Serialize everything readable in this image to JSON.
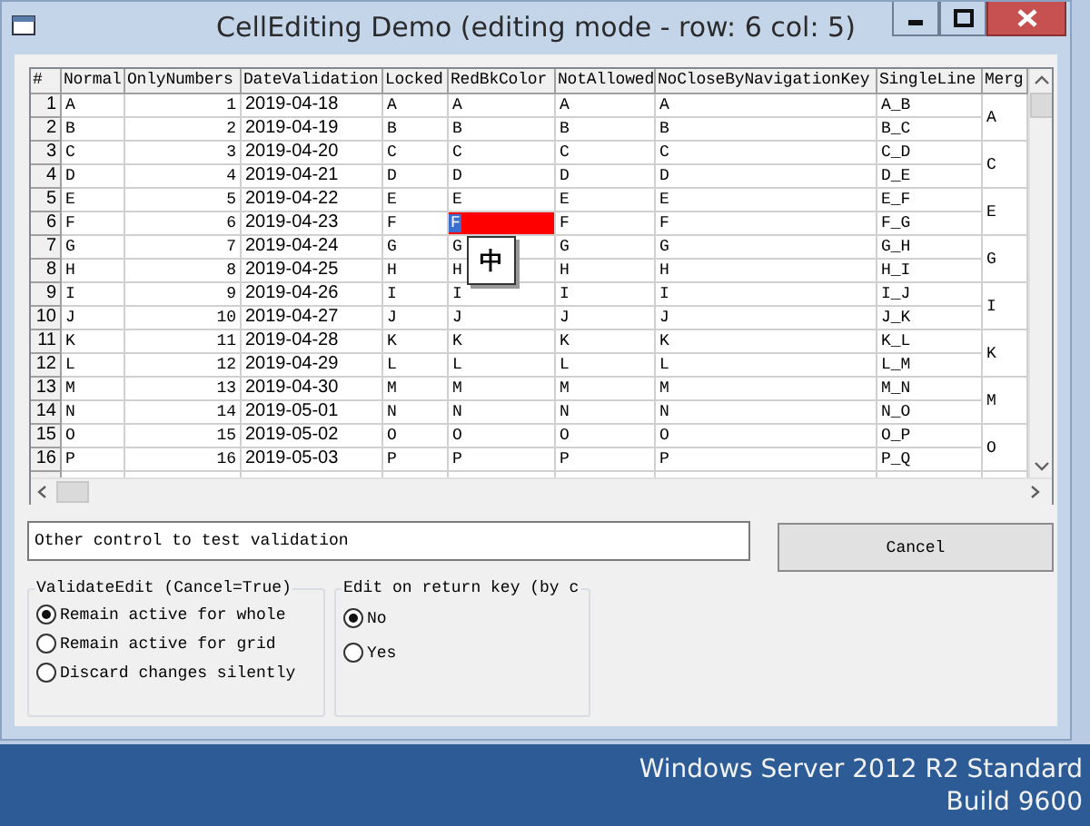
{
  "window": {
    "title": "CellEditing Demo (editing mode - row: 6 col: 5)"
  },
  "grid": {
    "columns": [
      {
        "label": "#",
        "kind": "rownum"
      },
      {
        "label": "Normal",
        "kind": "text"
      },
      {
        "label": "OnlyNumbers",
        "kind": "number"
      },
      {
        "label": "DateValidation",
        "kind": "text"
      },
      {
        "label": "Locked",
        "kind": "text"
      },
      {
        "label": "RedBkColor",
        "kind": "redbk"
      },
      {
        "label": "NotAllowed",
        "kind": "text"
      },
      {
        "label": "NoCloseByNavigationKey",
        "kind": "text"
      },
      {
        "label": "SingleLine",
        "kind": "text"
      },
      {
        "label": "Merg",
        "kind": "merged"
      }
    ],
    "rows": [
      {
        "cells": [
          "1",
          "A",
          "1",
          "2019-04-18",
          "A",
          "A",
          "A",
          "A",
          "A_B"
        ],
        "editing": false
      },
      {
        "cells": [
          "2",
          "B",
          "2",
          "2019-04-19",
          "B",
          "B",
          "B",
          "B",
          "B_C"
        ],
        "editing": false
      },
      {
        "cells": [
          "3",
          "C",
          "3",
          "2019-04-20",
          "C",
          "C",
          "C",
          "C",
          "C_D"
        ],
        "editing": false
      },
      {
        "cells": [
          "4",
          "D",
          "4",
          "2019-04-21",
          "D",
          "D",
          "D",
          "D",
          "D_E"
        ],
        "editing": false
      },
      {
        "cells": [
          "5",
          "E",
          "5",
          "2019-04-22",
          "E",
          "E",
          "E",
          "E",
          "E_F"
        ],
        "editing": false
      },
      {
        "cells": [
          "6",
          "F",
          "6",
          "2019-04-23",
          "F",
          "F",
          "F",
          "F",
          "F_G"
        ],
        "editing": true
      },
      {
        "cells": [
          "7",
          "G",
          "7",
          "2019-04-24",
          "G",
          "G",
          "G",
          "G",
          "G_H"
        ],
        "editing": false
      },
      {
        "cells": [
          "8",
          "H",
          "8",
          "2019-04-25",
          "H",
          "H",
          "H",
          "H",
          "H_I"
        ],
        "editing": false
      },
      {
        "cells": [
          "9",
          "I",
          "9",
          "2019-04-26",
          "I",
          "I",
          "I",
          "I",
          "I_J"
        ],
        "editing": false
      },
      {
        "cells": [
          "10",
          "J",
          "10",
          "2019-04-27",
          "J",
          "J",
          "J",
          "J",
          "J_K"
        ],
        "editing": false
      },
      {
        "cells": [
          "11",
          "K",
          "11",
          "2019-04-28",
          "K",
          "K",
          "K",
          "K",
          "K_L"
        ],
        "editing": false
      },
      {
        "cells": [
          "12",
          "L",
          "12",
          "2019-04-29",
          "L",
          "L",
          "L",
          "L",
          "L_M"
        ],
        "editing": false
      },
      {
        "cells": [
          "13",
          "M",
          "13",
          "2019-04-30",
          "M",
          "M",
          "M",
          "M",
          "M_N"
        ],
        "editing": false
      },
      {
        "cells": [
          "14",
          "N",
          "14",
          "2019-05-01",
          "N",
          "N",
          "N",
          "N",
          "N_O"
        ],
        "editing": false
      },
      {
        "cells": [
          "15",
          "O",
          "15",
          "2019-05-02",
          "O",
          "O",
          "O",
          "O",
          "O_P"
        ],
        "editing": false
      },
      {
        "cells": [
          "16",
          "P",
          "16",
          "2019-05-03",
          "P",
          "P",
          "P",
          "P",
          "P_Q"
        ],
        "editing": false
      }
    ],
    "merged_cells": [
      "A",
      "C",
      "E",
      "G",
      "I",
      "K",
      "M",
      "O"
    ],
    "ime_indicator": "中"
  },
  "validation_field": {
    "value": "Other control to test validation"
  },
  "cancel_button": {
    "label": "Cancel"
  },
  "groups": [
    {
      "title": "ValidateEdit (Cancel=True)",
      "options": [
        {
          "label": "Remain active for whole",
          "selected": true
        },
        {
          "label": "Remain active for grid",
          "selected": false
        },
        {
          "label": "Discard changes silently",
          "selected": false
        }
      ]
    },
    {
      "title": "Edit on return key (by c",
      "options": [
        {
          "label": "No",
          "selected": true
        },
        {
          "label": "Yes",
          "selected": false
        }
      ]
    }
  ],
  "desktop": {
    "edition": "Windows Server 2012 R2 Standard",
    "build": "Build 9600"
  }
}
